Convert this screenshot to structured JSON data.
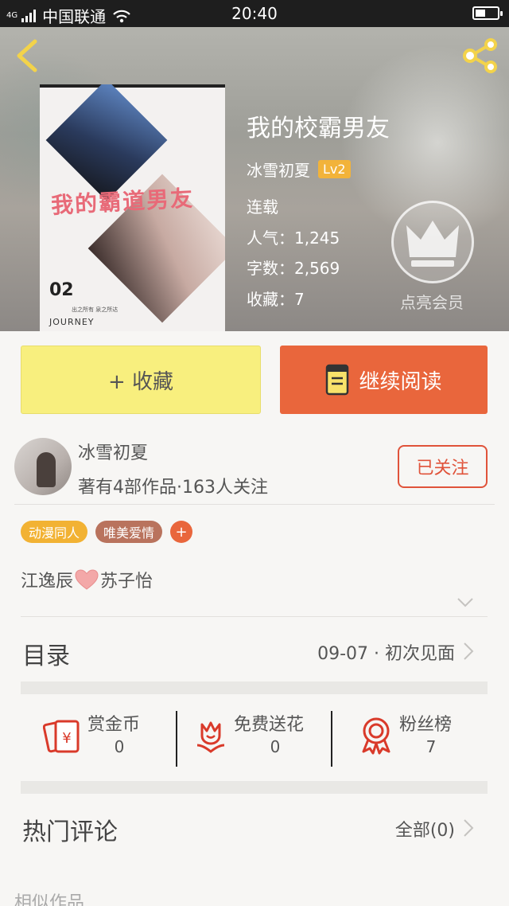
{
  "status_bar": {
    "network": "4G",
    "carrier": "中国联通",
    "time": "20:40"
  },
  "book": {
    "title": "我的校霸男友",
    "author": "冰雪初夏",
    "level": "Lv2",
    "status": "连载",
    "popularity": "人气：1,245",
    "word_count": "字数：2,569",
    "favorites": "收藏：7",
    "vip_label": "点亮会员",
    "cover": {
      "title_text": "我的霸道男友",
      "number": "02",
      "subtitle": "出之所有  泉之所达",
      "journey": "JOURNEY"
    }
  },
  "actions": {
    "favorite_label": "+ 收藏",
    "read_label": "继续阅读"
  },
  "author_card": {
    "name": "冰雪初夏",
    "stats": "著有4部作品·163人关注",
    "follow_label": "已关注"
  },
  "tags": [
    "动漫同人",
    "唯美爱情"
  ],
  "tag_add": "+",
  "intro": {
    "left": "江逸辰",
    "right": "苏子怡"
  },
  "toc": {
    "label": "目录",
    "latest": "09-07 · 初次见面"
  },
  "stats": [
    {
      "label": "赏金币",
      "value": "0",
      "icon": "red-envelope-icon"
    },
    {
      "label": "免费送花",
      "value": "0",
      "icon": "flower-icon"
    },
    {
      "label": "粉丝榜",
      "value": "7",
      "icon": "rosette-icon"
    }
  ],
  "comments": {
    "label": "热门评论",
    "all_label": "全部(0)"
  },
  "similar_label": "相似作品",
  "colors": {
    "accent": "#e9663c",
    "favorite_button": "#f8ef7e",
    "level_badge": "#f2b33a",
    "tag_orange": "#f2b233",
    "tag_brown": "#b9735d",
    "icon_red": "#d93a2a"
  }
}
